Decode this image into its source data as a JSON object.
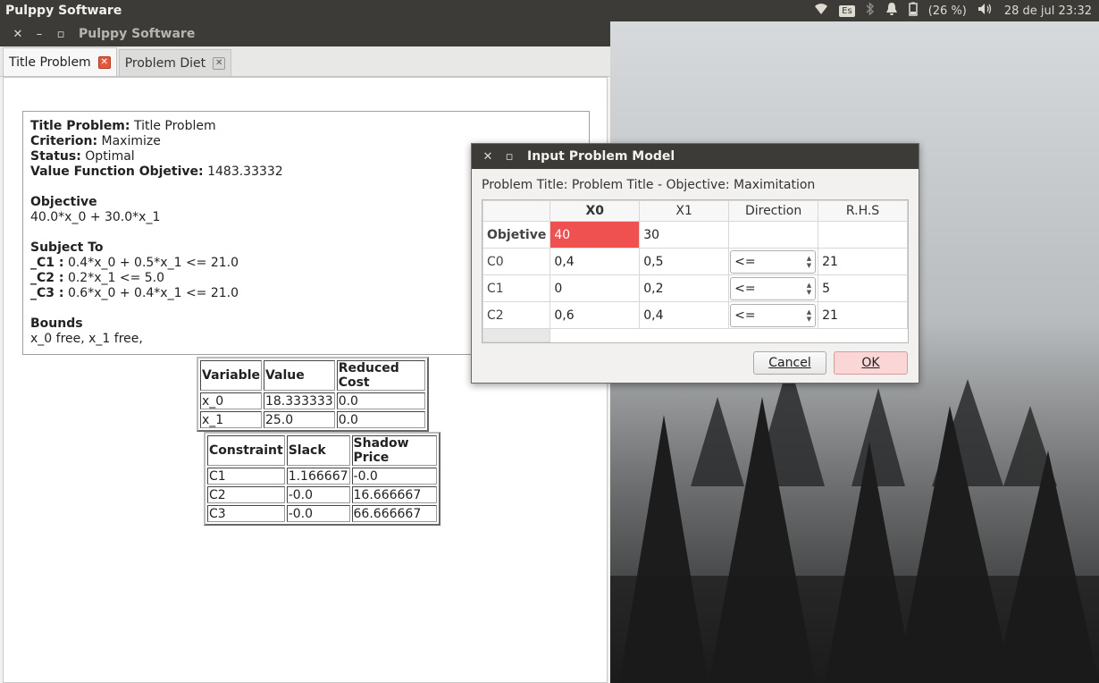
{
  "topbar": {
    "app_title": "Pulppy Software",
    "keyboard": "Es",
    "battery": "(26 %)",
    "datetime": "28 de jul 23:32"
  },
  "main_window": {
    "title": "Pulppy Software",
    "tabs": [
      {
        "label": "Title Problem",
        "active": true
      },
      {
        "label": "Problem Diet",
        "active": false
      }
    ],
    "summary": {
      "title_label": "Title Problem:",
      "title_value": "Title Problem",
      "criterion_label": "Criterion:",
      "criterion_value": "Maximize",
      "status_label": "Status:",
      "status_value": "Optimal",
      "vfo_label": "Value Function Objetive:",
      "vfo_value": "1483.33332",
      "objective_heading": "Objective",
      "objective_expr": "40.0*x_0 + 30.0*x_1",
      "subject_heading": "Subject To",
      "constraints": [
        {
          "name": "_C1 :",
          "expr": "0.4*x_0 + 0.5*x_1 <= 21.0"
        },
        {
          "name": "_C2 :",
          "expr": "0.2*x_1 <= 5.0"
        },
        {
          "name": "_C3 :",
          "expr": "0.6*x_0 + 0.4*x_1 <= 21.0"
        }
      ],
      "bounds_heading": "Bounds",
      "bounds_expr": "x_0 free, x_1 free,"
    },
    "variables_table": {
      "headers": [
        "Variable",
        "Value",
        "Reduced Cost"
      ],
      "rows": [
        [
          "x_0",
          "18.333333",
          "0.0"
        ],
        [
          "x_1",
          "25.0",
          "0.0"
        ]
      ]
    },
    "constraints_table": {
      "headers": [
        "Constraint",
        "Slack",
        "Shadow Price"
      ],
      "rows": [
        [
          "C1",
          "1.166667",
          "-0.0"
        ],
        [
          "C2",
          "-0.0",
          "16.666667"
        ],
        [
          "C3",
          "-0.0",
          "66.666667"
        ]
      ]
    }
  },
  "dialog": {
    "title": "Input Problem Model",
    "heading": "Problem Title: Problem Title - Objective: Maximitation",
    "columns": [
      "X0",
      "X1",
      "Direction",
      "R.H.S"
    ],
    "rows": [
      {
        "label": "Objetive",
        "x0": "40",
        "x1": "30",
        "dir": "",
        "rhs": ""
      },
      {
        "label": "C0",
        "x0": "0,4",
        "x1": "0,5",
        "dir": "<=",
        "rhs": "21"
      },
      {
        "label": "C1",
        "x0": "0",
        "x1": "0,2",
        "dir": "<=",
        "rhs": "5"
      },
      {
        "label": "C2",
        "x0": "0,6",
        "x1": "0,4",
        "dir": "<=",
        "rhs": "21"
      }
    ],
    "cancel_label": "Cancel",
    "ok_label": "OK"
  }
}
